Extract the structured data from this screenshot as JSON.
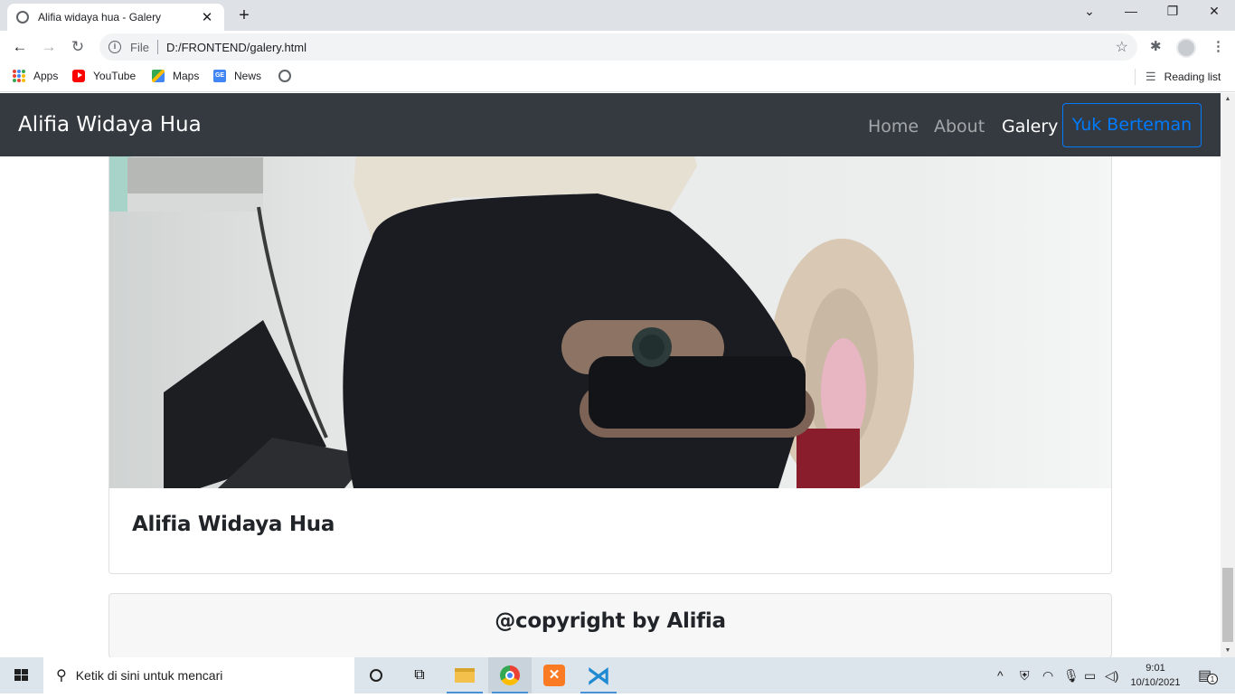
{
  "browser": {
    "tab_title": "Alifia widaya hua - Galery",
    "new_tab": "+",
    "file_label": "File",
    "url": "D:/FRONTEND/galery.html",
    "bookmarks": [
      "Apps",
      "YouTube",
      "Maps",
      "News"
    ],
    "reading_list": "Reading list"
  },
  "site": {
    "brand": "Alifia Widaya Hua",
    "nav": [
      "Home",
      "About",
      "Galery"
    ],
    "cta": "Yuk Berteman",
    "card_title": "Alifia Widaya Hua",
    "footer": "@copyright by Alifia"
  },
  "taskbar": {
    "search_placeholder": "Ketik di sini untuk mencari",
    "time": "9:01",
    "date": "10/10/2021",
    "notification_count": "1"
  },
  "colors": {
    "navbar_bg": "#343a40",
    "accent_blue": "#007bff"
  }
}
